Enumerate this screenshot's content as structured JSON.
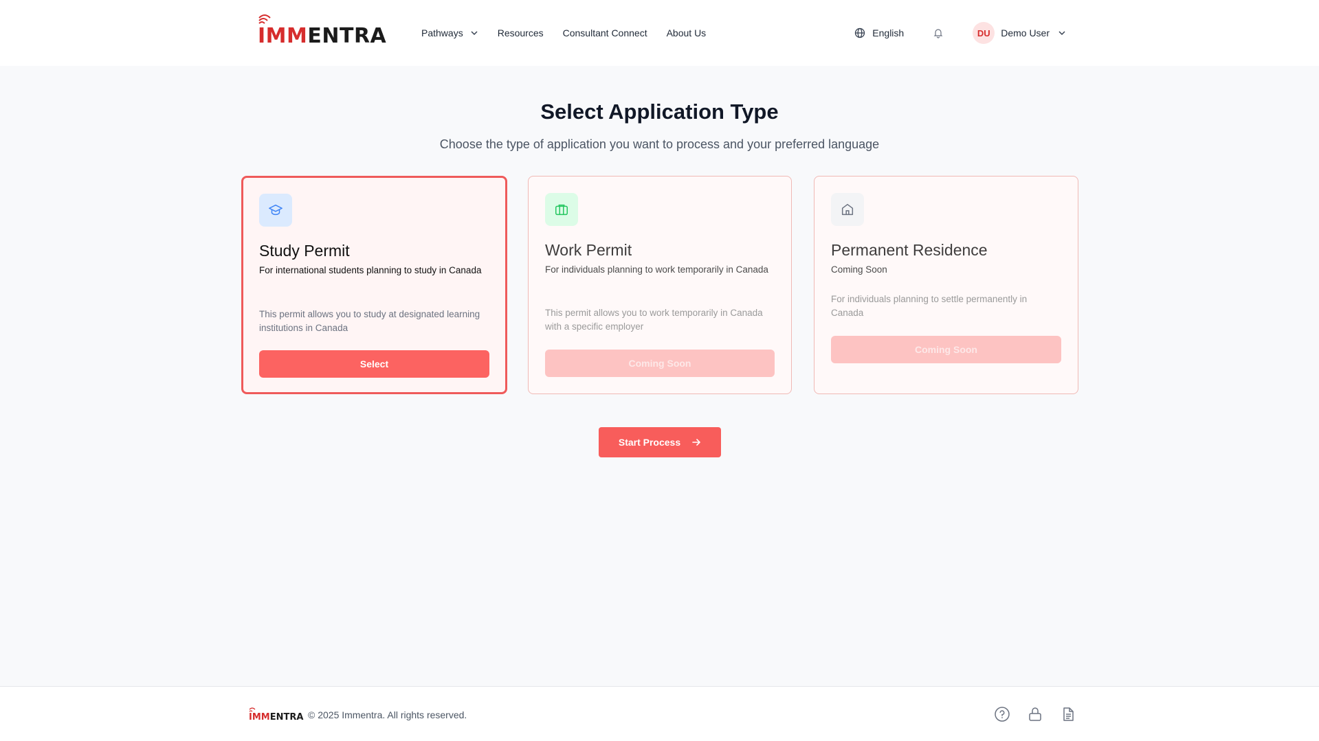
{
  "brand": {
    "name_red": "IMM",
    "name_dark": "ENTRA",
    "color": "#d62d2d"
  },
  "nav": {
    "items": [
      {
        "label": "Pathways",
        "has_dropdown": true
      },
      {
        "label": "Resources"
      },
      {
        "label": "Consultant Connect"
      },
      {
        "label": "About Us"
      }
    ]
  },
  "header": {
    "language": "English",
    "user": {
      "initials": "DU",
      "name": "Demo User"
    }
  },
  "main": {
    "title": "Select Application Type",
    "subtitle": "Choose the type of application you want to process and your preferred language",
    "cards": [
      {
        "title": "Study Permit",
        "subtitle": "For international students planning to study in Canada",
        "description": "This permit allows you to study at designated learning institutions in Canada",
        "button": "Select",
        "icon": "graduation-cap-icon",
        "selected": true
      },
      {
        "title": "Work Permit",
        "subtitle": "For individuals planning to work temporarily in Canada",
        "description": "This permit allows you to work temporarily in Canada with a specific employer",
        "button": "Coming Soon",
        "icon": "briefcase-icon",
        "selected": false
      },
      {
        "title": "Permanent Residence",
        "subtitle": "Coming Soon",
        "description": "For individuals planning to settle permanently in Canada",
        "button": "Coming Soon",
        "icon": "home-icon",
        "selected": false
      }
    ],
    "start_button": "Start Process"
  },
  "footer": {
    "copyright": "© 2025 Immentra. All rights reserved.",
    "icons": [
      "help-circle-icon",
      "lock-icon",
      "document-icon"
    ]
  },
  "colors": {
    "accent": "#fc6361",
    "accent_disabled": "#fdc3c2",
    "card_border": "#f0b9b5"
  }
}
